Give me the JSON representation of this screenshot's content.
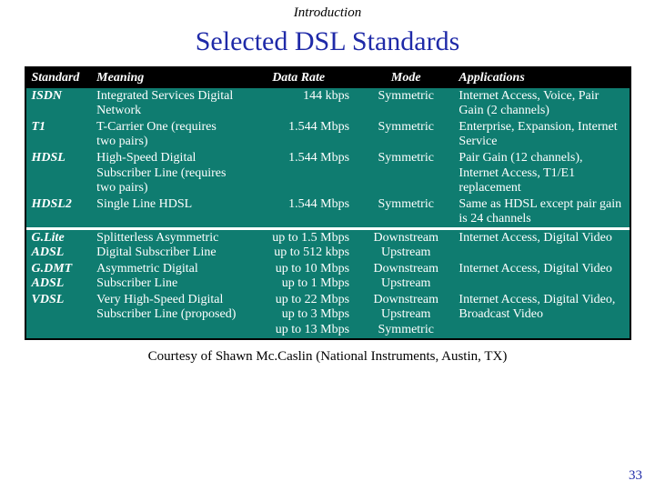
{
  "pretitle": "Introduction",
  "title": "Selected DSL Standards",
  "headers": {
    "standard": "Standard",
    "meaning": "Meaning",
    "rate": "Data Rate",
    "mode": "Mode",
    "applications": "Applications"
  },
  "rows_top": [
    {
      "standard": "ISDN",
      "meaning": "Integrated Services Digital Network",
      "rate": "144 kbps",
      "mode": "Symmetric",
      "applications": "Internet Access, Voice, Pair Gain (2 channels)"
    },
    {
      "standard": "T1",
      "meaning": "T-Carrier One (requires two pairs)",
      "rate": "1.544 Mbps",
      "mode": "Symmetric",
      "applications": "Enterprise, Expansion, Internet Service"
    },
    {
      "standard": "HDSL",
      "meaning": "High-Speed Digital Subscriber Line (requires two pairs)",
      "rate": "1.544 Mbps",
      "mode": "Symmetric",
      "applications": "Pair Gain (12 channels), Internet Access, T1/E1 replacement"
    },
    {
      "standard": "HDSL2",
      "meaning": "Single Line HDSL",
      "rate": "1.544 Mbps",
      "mode": "Symmetric",
      "applications": "Same as HDSL except pair gain is 24 channels"
    }
  ],
  "rows_bottom": [
    {
      "standard": "G.Lite ADSL",
      "meaning": "Splitterless Asymmetric Digital Subscriber Line",
      "rate_lines": [
        "up to 1.5 Mbps",
        "up to 512 kbps"
      ],
      "mode_lines": [
        "Downstream",
        "Upstream"
      ],
      "applications": "Internet Access, Digital Video"
    },
    {
      "standard": "G.DMT ADSL",
      "meaning": "Asymmetric Digital Subscriber Line",
      "rate_lines": [
        "up to 10 Mbps",
        "up to 1 Mbps"
      ],
      "mode_lines": [
        "Downstream",
        "Upstream"
      ],
      "applications": "Internet Access, Digital Video"
    },
    {
      "standard": "VDSL",
      "meaning": "Very High-Speed Digital Subscriber Line (proposed)",
      "rate_lines": [
        "up to 22 Mbps",
        "up to 3 Mbps",
        "up to 13 Mbps"
      ],
      "mode_lines": [
        "Downstream",
        "Upstream",
        "Symmetric"
      ],
      "applications": "Internet Access, Digital Video, Broadcast Video"
    }
  ],
  "credit": "Courtesy of Shawn Mc.Caslin (National Instruments, Austin, TX)",
  "slidenum": "33"
}
